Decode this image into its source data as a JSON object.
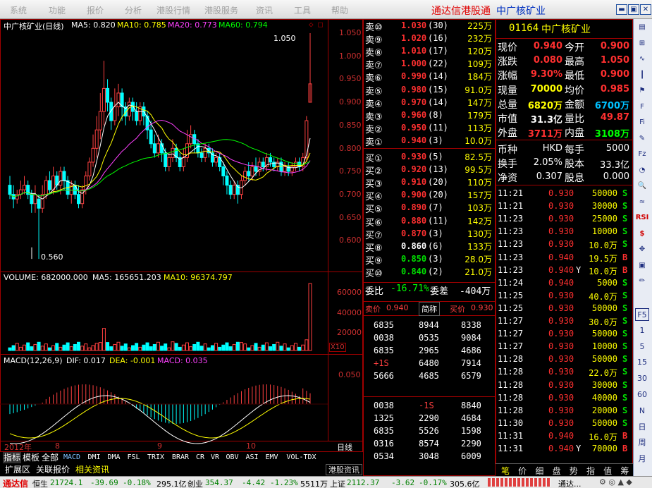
{
  "menu": [
    "系统",
    "功能",
    "报价",
    "分析",
    "港股行情",
    "港股服务",
    "资讯",
    "工具",
    "帮助"
  ],
  "brand": {
    "app": "通达信港股通",
    "stock": "中广核矿业"
  },
  "chart": {
    "title": "中广核矿业(日线)",
    "ma5_label": "MA5: 0.820",
    "ma10_label": "MA10: 0.785",
    "ma20_label": "MA20: 0.773",
    "ma60_label": "MA60: 0.794",
    "price_axis": [
      "1.050",
      "1.000",
      "0.950",
      "0.900",
      "0.850",
      "0.800",
      "0.750",
      "0.700",
      "0.650",
      "0.600"
    ],
    "high_mark": "1.050",
    "low_mark": "0.560",
    "volume_label": "VOLUME: 682000.000",
    "vol_ma5": "MA5: 165651.203",
    "vol_ma10": "MA10: 96374.797",
    "vol_axis": [
      "60000",
      "40000",
      "20000"
    ],
    "vol_unit": "X10",
    "macd_label": "MACD(12,26,9)",
    "macd_dif": "DIF: 0.017",
    "macd_dea": "DEA: -0.001",
    "macd_val": "MACD: 0.035",
    "macd_axis": "0.050",
    "date_labels": [
      "2012年",
      "8",
      "9",
      "10"
    ],
    "period": "日线"
  },
  "bottom_tabs": [
    "指标",
    "模板",
    "全部",
    "MACD",
    "DMI",
    "DMA",
    "FSL",
    "TRIX",
    "BRAR",
    "CR",
    "VR",
    "OBV",
    "ASI",
    "EMV",
    "VOL-TDX"
  ],
  "bottom_tabs2": [
    "扩展区",
    "关联报价",
    "相关资讯"
  ],
  "hk_tab": "港股资讯",
  "orderbook": {
    "sell": [
      {
        "label": "卖⑩",
        "price": "1.030",
        "n": "(30)",
        "vol": "225万"
      },
      {
        "label": "卖⑨",
        "price": "1.020",
        "n": "(16)",
        "vol": "232万"
      },
      {
        "label": "卖⑧",
        "price": "1.010",
        "n": "(17)",
        "vol": "120万"
      },
      {
        "label": "卖⑦",
        "price": "1.000",
        "n": "(22)",
        "vol": "109万"
      },
      {
        "label": "卖⑥",
        "price": "0.990",
        "n": "(14)",
        "vol": "184万"
      },
      {
        "label": "卖⑤",
        "price": "0.980",
        "n": "(15)",
        "vol": "91.0万"
      },
      {
        "label": "卖④",
        "price": "0.970",
        "n": "(14)",
        "vol": "147万"
      },
      {
        "label": "卖③",
        "price": "0.960",
        "n": "(8)",
        "vol": "179万"
      },
      {
        "label": "卖②",
        "price": "0.950",
        "n": "(11)",
        "vol": "113万"
      },
      {
        "label": "卖①",
        "price": "0.940",
        "n": "(3)",
        "vol": "10.0万"
      }
    ],
    "buy": [
      {
        "label": "买①",
        "price": "0.930",
        "n": "(5)",
        "vol": "82.5万",
        "pc": "#ff3030"
      },
      {
        "label": "买②",
        "price": "0.920",
        "n": "(13)",
        "vol": "99.5万",
        "pc": "#ff3030"
      },
      {
        "label": "买③",
        "price": "0.910",
        "n": "(20)",
        "vol": "110万",
        "pc": "#ff3030"
      },
      {
        "label": "买④",
        "price": "0.900",
        "n": "(20)",
        "vol": "157万",
        "pc": "#ff3030"
      },
      {
        "label": "买⑤",
        "price": "0.890",
        "n": "(7)",
        "vol": "103万",
        "pc": "#ff3030"
      },
      {
        "label": "买⑥",
        "price": "0.880",
        "n": "(11)",
        "vol": "142万",
        "pc": "#ff3030"
      },
      {
        "label": "买⑦",
        "price": "0.870",
        "n": "(3)",
        "vol": "130万",
        "pc": "#ff3030"
      },
      {
        "label": "买⑧",
        "price": "0.860",
        "n": "(6)",
        "vol": "133万",
        "pc": "#ffffff"
      },
      {
        "label": "买⑨",
        "price": "0.850",
        "n": "(3)",
        "vol": "28.0万",
        "pc": "#00e000"
      },
      {
        "label": "买⑩",
        "price": "0.840",
        "n": "(2)",
        "vol": "21.0万",
        "pc": "#00e000"
      }
    ],
    "weibi_label": "委比",
    "weibi": "-16.71%",
    "weicha_label": "委差",
    "weicha": "-404万",
    "sell_price_label": "卖价",
    "sell_price": "0.940",
    "brokers_label": "简称",
    "buy_price_label": "买价",
    "buy_price": "0.930",
    "brokers_top": [
      [
        "6835",
        "8944",
        "8338"
      ],
      [
        "0038",
        "0535",
        "9084"
      ],
      [
        "6835",
        "2965",
        "4686"
      ],
      [
        "+1S",
        "6480",
        "7914"
      ],
      [
        "5666",
        "4685",
        "6579"
      ]
    ],
    "brokers_bottom": [
      [
        "0038",
        "-1S",
        "8840"
      ],
      [
        "1325",
        "2290",
        "4684"
      ],
      [
        "6835",
        "5526",
        "1598"
      ],
      [
        "0316",
        "8574",
        "2290"
      ],
      [
        "0534",
        "3048",
        "6009"
      ]
    ]
  },
  "quote": {
    "code": "01164",
    "name": "中广核矿业",
    "rows": [
      [
        "现价",
        "0.940",
        "今开",
        "0.900"
      ],
      [
        "涨跌",
        "0.080",
        "最高",
        "1.050"
      ],
      [
        "涨幅",
        "9.30%",
        "最低",
        "0.900"
      ],
      [
        "现量",
        "70000",
        "均价",
        "0.985"
      ],
      [
        "总量",
        "6820万",
        "金额",
        "6700万"
      ],
      [
        "市值",
        "31.3亿",
        "量比",
        "49.87"
      ],
      [
        "外盘",
        "3711万",
        "内盘",
        "3108万"
      ]
    ],
    "info": [
      [
        "币种",
        "HKD",
        "每手",
        "5000"
      ],
      [
        "换手",
        "2.05%",
        "股本",
        "33.3亿"
      ],
      [
        "净资",
        "0.307",
        "股息",
        "0.000"
      ]
    ]
  },
  "ticks": [
    [
      "11:21",
      "0.930",
      "",
      "50000",
      "S"
    ],
    [
      "11:21",
      "0.930",
      "",
      "30000",
      "S"
    ],
    [
      "11:23",
      "0.930",
      "",
      "25000",
      "S"
    ],
    [
      "11:23",
      "0.930",
      "",
      "10000",
      "S"
    ],
    [
      "11:23",
      "0.930",
      "",
      "10.0万",
      "S"
    ],
    [
      "11:23",
      "0.940",
      "",
      "19.5万",
      "B"
    ],
    [
      "11:23",
      "0.940",
      "Y",
      "10.0万",
      "B"
    ],
    [
      "11:24",
      "0.940",
      "",
      "5000",
      "S"
    ],
    [
      "11:25",
      "0.930",
      "",
      "40.0万",
      "S"
    ],
    [
      "11:25",
      "0.930",
      "",
      "50000",
      "S"
    ],
    [
      "11:27",
      "0.930",
      "",
      "30.0万",
      "S"
    ],
    [
      "11:27",
      "0.930",
      "",
      "50000",
      "S"
    ],
    [
      "11:27",
      "0.930",
      "",
      "10000",
      "S"
    ],
    [
      "11:28",
      "0.930",
      "",
      "50000",
      "S"
    ],
    [
      "11:28",
      "0.930",
      "",
      "22.0万",
      "S"
    ],
    [
      "11:28",
      "0.930",
      "",
      "30000",
      "S"
    ],
    [
      "11:28",
      "0.930",
      "",
      "40000",
      "S"
    ],
    [
      "11:28",
      "0.930",
      "",
      "20000",
      "S"
    ],
    [
      "11:30",
      "0.930",
      "",
      "50000",
      "S"
    ],
    [
      "11:31",
      "0.940",
      "",
      "16.0万",
      "B"
    ],
    [
      "11:31",
      "0.940",
      "Y",
      "70000",
      "B"
    ]
  ],
  "right_tabs": [
    "笔",
    "价",
    "细",
    "盘",
    "势",
    "指",
    "值",
    "筹"
  ],
  "toolbar_icons": [
    "doc-icon",
    "chart-icon",
    "line-icon",
    "candle-icon",
    "flag-icon",
    "f10-icon",
    "fio-icon",
    "note-icon",
    "fiz-icon",
    "pie-icon",
    "search-icon",
    "wave-icon",
    "rsi-icon",
    "dollar-icon",
    "arrows-icon",
    "box-icon",
    "pencil-icon"
  ],
  "toolbar_labels": [
    "F5",
    "1",
    "5",
    "15",
    "30",
    "60",
    "N",
    "日",
    "周",
    "月"
  ],
  "status": {
    "logo": "通达信",
    "index1": "恒生",
    "i1v": "21724.1",
    "i1c": "-39.69",
    "i1p": "-0.18%",
    "i1a": "295.1亿",
    "index2": "创业",
    "i2v": "354.37",
    "i2c": "-4.42",
    "i2p": "-1.23%",
    "i2a": "5511万",
    "index3": "上证",
    "i3v": "2112.37",
    "i3c": "-3.62",
    "i3p": "-0.17%",
    "i3a": "305.6亿",
    "right": "通达..."
  }
}
